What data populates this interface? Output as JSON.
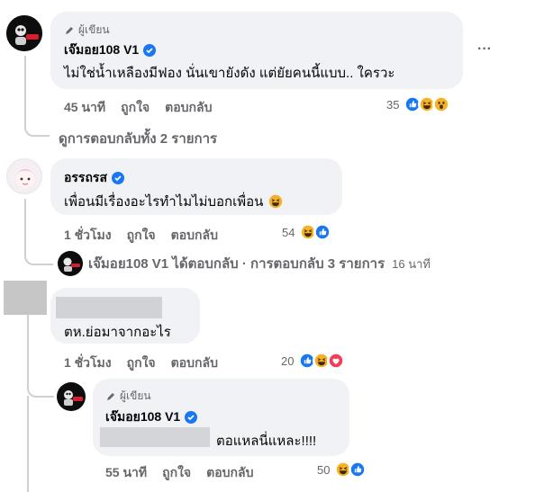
{
  "comments": [
    {
      "author_badge": "ผู้เขียน",
      "author": "เจ๊มอย108 V1",
      "text": "ไม่ใช่น้ำเหลืองมีฟอง นั่นเขายังดัง แต่ยัยคนนี้แบบ.. ใครวะ",
      "time": "45 นาที",
      "like": "ถูกใจ",
      "reply": "ตอบกลับ",
      "reaction_count": "35",
      "more": "···",
      "view_replies": "ดูการตอบกลับทั้ง 2 รายการ"
    },
    {
      "author": "อรรถรส",
      "text": "เพื่อนมีเรื่องอะไรทำไมไม่บอกเพื่อน",
      "time": "1 ชั่วโมง",
      "like": "ถูกใจ",
      "reply": "ตอบกลับ",
      "reaction_count": "54",
      "reply_summary": "เจ๊มอย108 V1 ได้ตอบกลับ · การตอบกลับ 3 รายการ",
      "reply_summary_time": "16 นาที"
    },
    {
      "text": "ตห.ย่อมาจากอะไร",
      "time": "1 ชั่วโมง",
      "like": "ถูกใจ",
      "reply": "ตอบกลับ",
      "reaction_count": "20"
    },
    {
      "author_badge": "ผู้เขียน",
      "author": "เจ๊มอย108 V1",
      "text": "ตอแหลนี่แหละ!!!!",
      "time": "55 นาที",
      "like": "ถูกใจ",
      "reply": "ตอบกลับ",
      "reaction_count": "50"
    }
  ],
  "colors": {
    "bubble": "#f0f2f5",
    "verified": "#1877f2",
    "like_blue": "#1877f2",
    "haha_yellow": "#f7b125",
    "love_red": "#f33e58",
    "meta_text": "#65676b"
  },
  "icons": [
    "pen-icon",
    "verified-badge-icon",
    "more-icon",
    "like-reaction-icon",
    "haha-reaction-icon",
    "wow-reaction-icon",
    "love-reaction-icon",
    "laughing-emoji-icon"
  ]
}
